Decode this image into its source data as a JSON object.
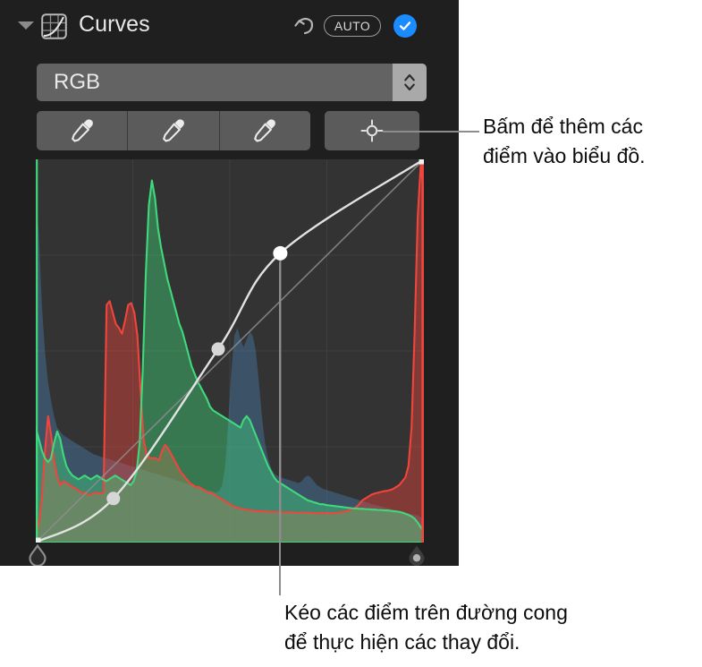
{
  "panel": {
    "header": {
      "title": "Curves",
      "disclosure_icon": "disclosure-triangle-down-icon",
      "curves_icon": "curves-grid-icon",
      "reset_icon": "reset-undo-arrow-icon",
      "auto_label": "AUTO",
      "check_icon": "checkmark-icon",
      "accent_color": "#1a8cff"
    },
    "channel_select": {
      "value": "RGB",
      "stepper_icon": "stepper-up-down-icon",
      "options": [
        "RGB"
      ]
    },
    "tools": {
      "eyedroppers": [
        {
          "name": "black-point-eyedropper",
          "icon": "eyedropper-icon"
        },
        {
          "name": "gray-point-eyedropper",
          "icon": "eyedropper-icon"
        },
        {
          "name": "white-point-eyedropper",
          "icon": "eyedropper-icon"
        }
      ],
      "add_point": {
        "name": "add-point-button",
        "icon": "target-crosshair-icon"
      }
    },
    "graph": {
      "background_color": "#333333",
      "grid_color": "#3f3f3f",
      "curve_color": "#e0e0e0",
      "handle_left_icon": "black-point-handle-icon",
      "handle_right_icon": "white-point-handle-icon"
    }
  },
  "callouts": [
    {
      "id": "add-points-callout",
      "text": "Bấm để thêm các điểm vào biểu đồ.",
      "line1": "Bấm để thêm các",
      "line2": "điểm vào biểu đồ."
    },
    {
      "id": "drag-points-callout",
      "text": "Kéo các điểm trên đường cong để thực hiện các thay đổi.",
      "line1": "Kéo các điểm trên đường cong",
      "line2": "để thực hiện các thay đổi."
    }
  ],
  "chart_data": {
    "type": "area",
    "title": "RGB Curves histogram",
    "xlabel": "",
    "ylabel": "",
    "xlim": [
      0,
      255
    ],
    "ylim": [
      0,
      1
    ],
    "grid": true,
    "grid_divisions": 4,
    "legend": "none",
    "colors": {
      "red": "#f0453c",
      "green": "#3fd97c",
      "blue": "#4a7fae",
      "curve": "#e2e2e2",
      "diagonal": "#8d8d8d"
    },
    "curve_points": [
      {
        "name": "black-point",
        "x": 0,
        "y": 0
      },
      {
        "name": "shadow-point",
        "x": 0.2,
        "y": 0.115
      },
      {
        "name": "midtone-point",
        "x": 0.47,
        "y": 0.505
      },
      {
        "name": "highlight-point",
        "x": 0.63,
        "y": 0.755
      },
      {
        "name": "white-point",
        "x": 1,
        "y": 1
      }
    ],
    "series": [
      {
        "name": "red",
        "color": "#f0453c",
        "values": [
          0.02,
          0.05,
          0.12,
          0.24,
          0.33,
          0.28,
          0.21,
          0.17,
          0.15,
          0.16,
          0.155,
          0.15,
          0.145,
          0.14,
          0.135,
          0.13,
          0.13,
          0.125,
          0.125,
          0.13,
          0.13,
          0.128,
          0.13,
          0.62,
          0.63,
          0.6,
          0.57,
          0.56,
          0.545,
          0.58,
          0.62,
          0.625,
          0.6,
          0.54,
          0.4,
          0.27,
          0.23,
          0.22,
          0.22,
          0.22,
          0.215,
          0.24,
          0.255,
          0.245,
          0.23,
          0.215,
          0.2,
          0.185,
          0.175,
          0.165,
          0.155,
          0.15,
          0.145,
          0.145,
          0.14,
          0.135,
          0.13,
          0.13,
          0.125,
          0.12,
          0.115,
          0.11,
          0.105,
          0.1,
          0.095,
          0.092,
          0.09,
          0.088,
          0.086,
          0.085,
          0.084,
          0.083,
          0.082,
          0.082,
          0.081,
          0.081,
          0.08,
          0.08,
          0.08,
          0.08,
          0.079,
          0.079,
          0.079,
          0.079,
          0.078,
          0.078,
          0.078,
          0.078,
          0.078,
          0.078,
          0.077,
          0.077,
          0.077,
          0.077,
          0.077,
          0.077,
          0.077,
          0.077,
          0.078,
          0.079,
          0.08,
          0.082,
          0.085,
          0.088,
          0.092,
          0.1,
          0.11,
          0.115,
          0.12,
          0.125,
          0.128,
          0.13,
          0.132,
          0.134,
          0.135,
          0.137,
          0.14,
          0.145,
          0.15,
          0.16,
          0.17,
          0.2,
          0.3,
          0.55,
          0.85,
          0.99,
          0.9
        ],
        "description": "Red channel histogram, twin peak in shadows/low-mids, spike at far right (clipped whites)"
      },
      {
        "name": "green",
        "color": "#3fd97c",
        "values": [
          0.3,
          0.27,
          0.24,
          0.22,
          0.21,
          0.22,
          0.26,
          0.29,
          0.27,
          0.23,
          0.2,
          0.185,
          0.175,
          0.17,
          0.165,
          0.17,
          0.175,
          0.17,
          0.165,
          0.17,
          0.175,
          0.17,
          0.165,
          0.16,
          0.165,
          0.17,
          0.175,
          0.17,
          0.165,
          0.16,
          0.155,
          0.15,
          0.16,
          0.185,
          0.26,
          0.45,
          0.7,
          0.88,
          0.945,
          0.9,
          0.82,
          0.77,
          0.73,
          0.69,
          0.66,
          0.63,
          0.6,
          0.57,
          0.55,
          0.52,
          0.49,
          0.46,
          0.44,
          0.42,
          0.405,
          0.39,
          0.375,
          0.355,
          0.345,
          0.34,
          0.335,
          0.33,
          0.325,
          0.32,
          0.315,
          0.31,
          0.305,
          0.3,
          0.32,
          0.33,
          0.32,
          0.3,
          0.28,
          0.26,
          0.24,
          0.22,
          0.2,
          0.185,
          0.17,
          0.16,
          0.155,
          0.15,
          0.145,
          0.14,
          0.135,
          0.13,
          0.125,
          0.12,
          0.115,
          0.11,
          0.108,
          0.105,
          0.103,
          0.1,
          0.1,
          0.098,
          0.097,
          0.096,
          0.095,
          0.094,
          0.093,
          0.092,
          0.091,
          0.09,
          0.089,
          0.089,
          0.088,
          0.088,
          0.087,
          0.087,
          0.086,
          0.086,
          0.085,
          0.085,
          0.084,
          0.084,
          0.083,
          0.082,
          0.081,
          0.08,
          0.078,
          0.075,
          0.072,
          0.068,
          0.062,
          0.052,
          0.04,
          0.025
        ],
        "description": "Green channel, dominant single tall peak around 30% of range"
      },
      {
        "name": "blue",
        "color": "#4a7fae",
        "values": [
          0.95,
          0.8,
          0.62,
          0.5,
          0.42,
          0.37,
          0.33,
          0.3,
          0.29,
          0.28,
          0.275,
          0.27,
          0.265,
          0.26,
          0.255,
          0.25,
          0.245,
          0.24,
          0.235,
          0.23,
          0.228,
          0.225,
          0.222,
          0.22,
          0.218,
          0.215,
          0.212,
          0.21,
          0.208,
          0.205,
          0.202,
          0.2,
          0.198,
          0.195,
          0.192,
          0.19,
          0.188,
          0.185,
          0.182,
          0.18,
          0.178,
          0.175,
          0.172,
          0.17,
          0.168,
          0.165,
          0.162,
          0.16,
          0.158,
          0.155,
          0.152,
          0.15,
          0.148,
          0.145,
          0.142,
          0.14,
          0.138,
          0.135,
          0.133,
          0.13,
          0.135,
          0.15,
          0.2,
          0.32,
          0.45,
          0.54,
          0.56,
          0.53,
          0.51,
          0.53,
          0.55,
          0.54,
          0.5,
          0.42,
          0.33,
          0.26,
          0.22,
          0.195,
          0.18,
          0.175,
          0.17,
          0.168,
          0.165,
          0.163,
          0.16,
          0.158,
          0.155,
          0.16,
          0.17,
          0.175,
          0.17,
          0.16,
          0.15,
          0.145,
          0.14,
          0.138,
          0.135,
          0.133,
          0.13,
          0.128,
          0.125,
          0.123,
          0.12,
          0.118,
          0.115,
          0.113,
          0.11,
          0.108,
          0.105,
          0.103,
          0.1,
          0.098,
          0.096,
          0.094,
          0.092,
          0.09,
          0.088,
          0.086,
          0.084,
          0.082,
          0.08,
          0.078,
          0.076,
          0.074,
          0.072,
          0.07,
          0.066,
          0.06
        ],
        "description": "Blue channel, tall spike at far left and broad mound in upper-mids"
      }
    ]
  }
}
